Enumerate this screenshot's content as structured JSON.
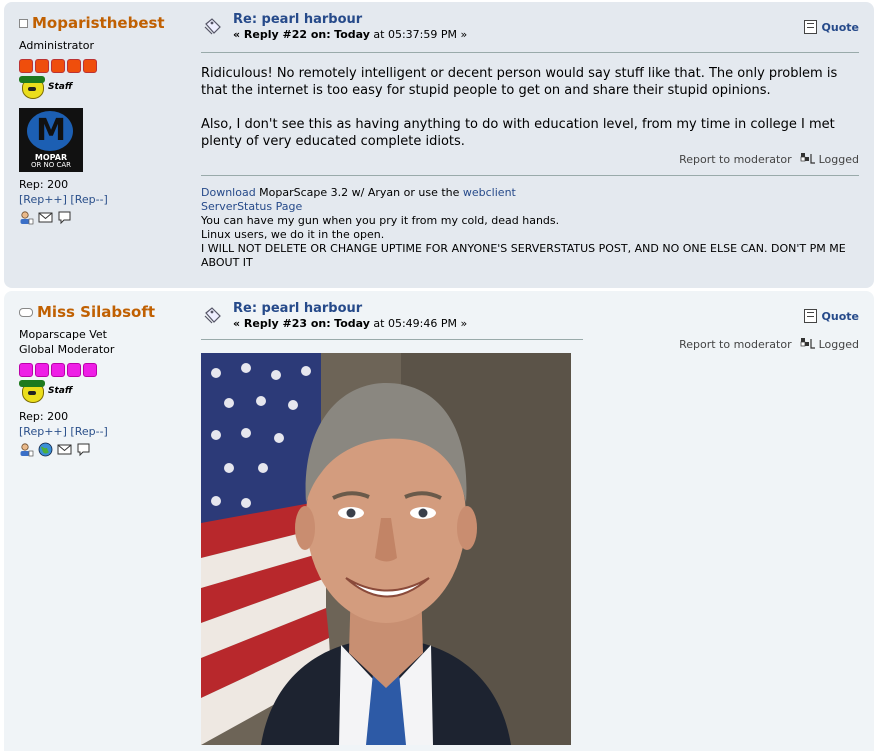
{
  "posts": [
    {
      "username": "Moparisthebest",
      "group_lines": [
        "Administrator"
      ],
      "staff_label": "Staff",
      "avatar_text": [
        "MOPAR",
        "OR NO CAR"
      ],
      "rep": "Rep: 200",
      "rep_plus": "[Rep++]",
      "rep_minus": "[Rep--]",
      "subject": "Re: pearl harbour",
      "reply_label": "« Reply #22 on:",
      "reply_day": "Today",
      "reply_time": "at 05:37:59 PM »",
      "quote_label": "Quote",
      "message": [
        "Ridiculous!  No remotely intelligent or decent person would say stuff like that.  The only problem is that the internet is too easy for stupid people to get on and share their stupid opinions.",
        "Also, I don't see this as having anything to do with education level, from my time in college I met plenty of very educated complete idiots."
      ],
      "report_label": "Report to moderator",
      "logged_label": "Logged",
      "signature": {
        "download_label": "Download",
        "download_rest": " MoparScape 3.2 w/ Aryan or use the ",
        "webclient_label": "webclient",
        "serverstatus_label": "ServerStatus Page",
        "line3": "You can have my gun when you pry it from my cold, dead hands.",
        "line4": "Linux users, we do it in the open.",
        "line5": "I WILL NOT DELETE OR CHANGE UPTIME FOR ANYONE'S SERVERSTATUS POST, AND NO ONE ELSE CAN.  DON'T PM ME ABOUT IT"
      }
    },
    {
      "username": "Miss Silabsoft",
      "group_lines": [
        "Moparscape Vet",
        "Global Moderator"
      ],
      "staff_label": "Staff",
      "rep": "Rep: 200",
      "rep_plus": "[Rep++]",
      "rep_minus": "[Rep--]",
      "subject": "Re: pearl harbour",
      "reply_label": "« Reply #23 on:",
      "reply_day": "Today",
      "reply_time": "at 05:49:46 PM »",
      "quote_label": "Quote",
      "report_label": "Report to moderator",
      "logged_label": "Logged"
    }
  ],
  "colors": {
    "username": "#c06002",
    "link": "#264a8a",
    "post1_bg": "#e4e9ef",
    "post2_bg": "#f0f4f7",
    "star_admin": "#ef4e0c",
    "star_mod": "#ee1ee6"
  },
  "icons": [
    "profile-icon",
    "email-icon",
    "pm-icon",
    "website-icon",
    "topic-icon",
    "quote-icon",
    "logged-ip-icon"
  ]
}
